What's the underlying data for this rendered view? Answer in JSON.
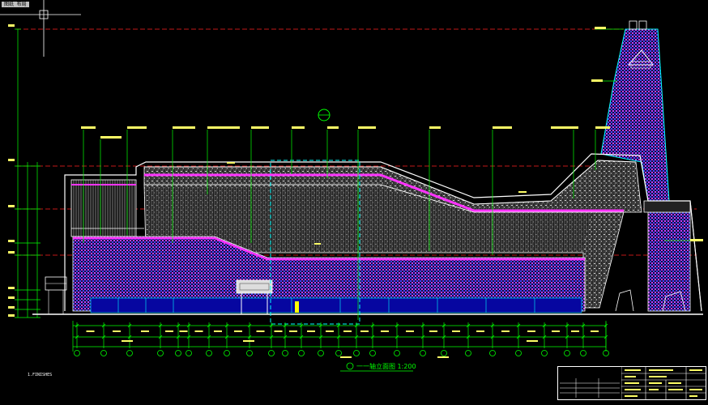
{
  "app": {
    "toolbar_tag": "图纸 布局"
  },
  "drawing": {
    "title": "一一轴立面图",
    "scale": "1:200",
    "note": "1.FINISHES",
    "colors": {
      "background": "#000000",
      "axis": "#00ff00",
      "datum": "#ff0000",
      "outline": "#ffffff",
      "cladding": "#ff00ff",
      "glass": "#0000ff",
      "highlight": "#00ffff",
      "fill": "#808080",
      "accent": "#ffff00"
    }
  }
}
